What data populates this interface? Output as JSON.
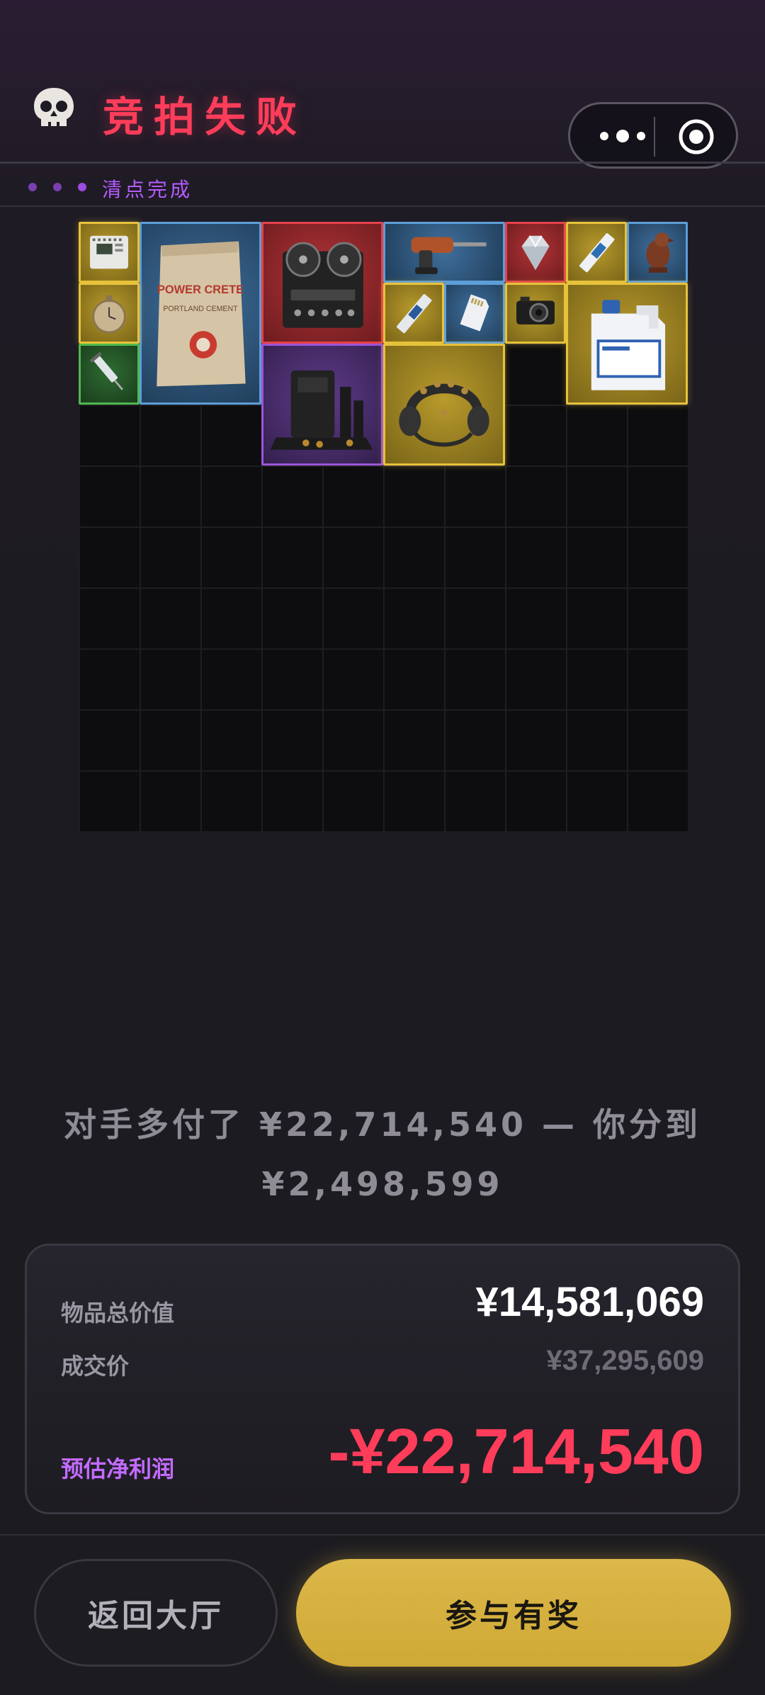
{
  "header": {
    "title": "竞拍失败",
    "status_text": "清点完成",
    "skull_icon": "skull-icon",
    "more_icon": "more-dots-icon",
    "close_icon": "target-circle-icon",
    "colors": {
      "title": "#ff3d5a",
      "status": "#b65bff"
    }
  },
  "inventory": {
    "grid_size": "10x10",
    "items": [
      {
        "name": "plc-controller",
        "rarity": "gold"
      },
      {
        "name": "cement-bag",
        "rarity": "blue",
        "label_line1": "POWER CRETE",
        "label_line2": "PORTLAND CEMENT"
      },
      {
        "name": "reel-to-reel-tape-recorder",
        "rarity": "red"
      },
      {
        "name": "power-drill",
        "rarity": "blue"
      },
      {
        "name": "diamond",
        "rarity": "red"
      },
      {
        "name": "ssd-drive",
        "rarity": "gold"
      },
      {
        "name": "bird-figurine",
        "rarity": "blue"
      },
      {
        "name": "pocket-watch",
        "rarity": "gold"
      },
      {
        "name": "m2-ssd",
        "rarity": "gold"
      },
      {
        "name": "sd-card",
        "rarity": "blue"
      },
      {
        "name": "camera",
        "rarity": "gold"
      },
      {
        "name": "chemical-jug",
        "rarity": "gold"
      },
      {
        "name": "syringe",
        "rarity": "green"
      },
      {
        "name": "coffee-machine",
        "rarity": "purple"
      },
      {
        "name": "headset",
        "rarity": "gold"
      }
    ]
  },
  "message": {
    "line1": "对手多付了 ¥22,714,540 — 你分到",
    "line2": "¥2,498,599"
  },
  "summary": {
    "total_label": "物品总价值",
    "total_value": "¥14,581,069",
    "deal_label": "成交价",
    "deal_value": "¥37,295,609",
    "profit_label": "预估净利润",
    "profit_value": "-¥22,714,540"
  },
  "actions": {
    "lobby_label": "返回大厅",
    "join_label": "参与有奖"
  }
}
